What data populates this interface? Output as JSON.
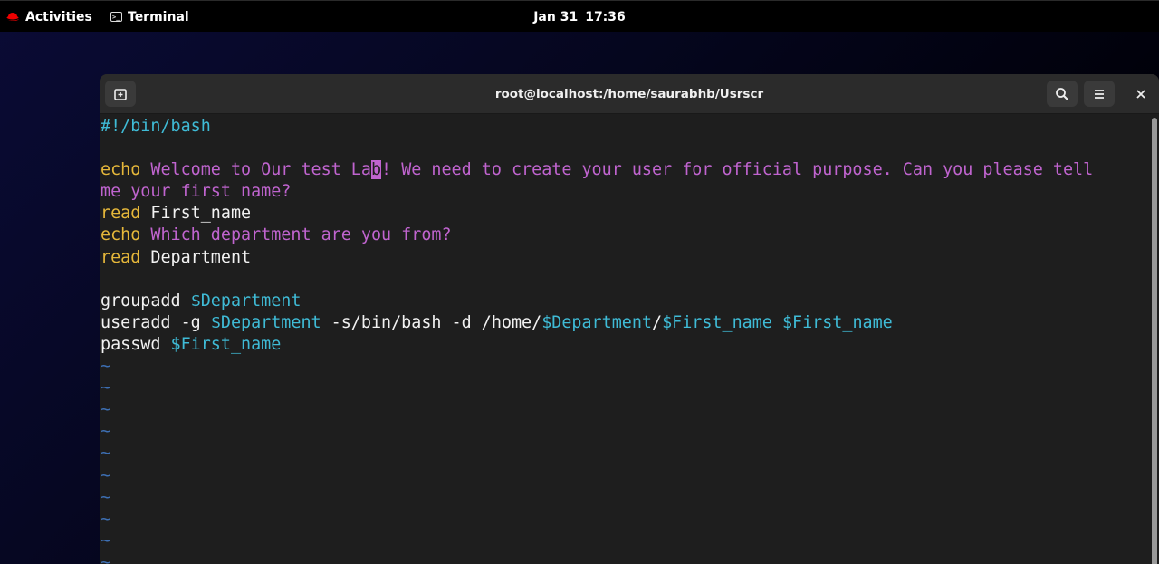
{
  "topbar": {
    "activities_label": "Activities",
    "app_label": "Terminal",
    "date": "Jan 31",
    "time": "17:36"
  },
  "window": {
    "title": "root@localhost:/home/saurabhb/Usrscr",
    "icons": {
      "new_tab": "new-tab-icon",
      "search": "search-icon",
      "menu": "hamburger-menu-icon",
      "close": "close-icon"
    }
  },
  "editor": {
    "shebang": "#!/bin/bash",
    "line_echo1_kw": "echo",
    "line_echo1_a": " Welcome to Our test La",
    "line_echo1_cursor": "b",
    "line_echo1_b": "! We need to create your user for official purpose. Can you please tell",
    "line_echo1_wrap": "me your first name?",
    "line_read1_kw": "read",
    "line_read1_rest": " First_name",
    "line_echo2_kw": "echo",
    "line_echo2_rest": " Which department are you from?",
    "line_read2_kw": "read",
    "line_read2_rest": " Department",
    "line_groupadd_cmd": "groupadd ",
    "line_groupadd_var": "$Department",
    "line_useradd_cmd": "useradd -g ",
    "line_useradd_var1": "$Department",
    "line_useradd_mid": " -s/bin/bash -d /home/",
    "line_useradd_var2": "$Department",
    "line_useradd_slash": "/",
    "line_useradd_var3": "$First_name",
    "line_useradd_sp": " ",
    "line_useradd_var4": "$First_name",
    "line_passwd_cmd": "passwd ",
    "line_passwd_var": "$First_name",
    "tilde": "~"
  },
  "colors": {
    "keyword": "#e6b83a",
    "string": "#c064cf",
    "variable": "#3fbbd6",
    "tilde": "#3d6fb3",
    "background": "#1e1e1e"
  }
}
